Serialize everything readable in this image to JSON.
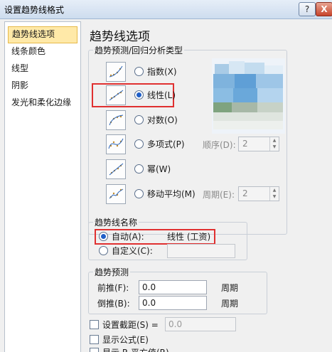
{
  "window": {
    "title": "设置趋势线格式",
    "help_label": "?",
    "close_label": "X"
  },
  "sidebar": {
    "items": [
      {
        "label": "趋势线选项"
      },
      {
        "label": "线条颜色"
      },
      {
        "label": "线型"
      },
      {
        "label": "阴影"
      },
      {
        "label": "发光和柔化边缘"
      }
    ]
  },
  "main": {
    "title": "趋势线选项",
    "type_group": {
      "label": "趋势预测/回归分析类型",
      "options": [
        {
          "label": "指数(X)"
        },
        {
          "label": "线性(L)"
        },
        {
          "label": "对数(O)"
        },
        {
          "label": "多项式(P)"
        },
        {
          "label": "幂(W)"
        },
        {
          "label": "移动平均(M)"
        }
      ],
      "selected": "线性(L)",
      "order_label": "顺序(D):",
      "order_value": "2",
      "period_label": "周期(E):",
      "period_value": "2"
    },
    "name_group": {
      "label": "趋势线名称",
      "auto_label": "自动(A):",
      "auto_value": "线性 (工资)",
      "custom_label": "自定义(C):",
      "custom_value": ""
    },
    "forecast_group": {
      "label": "趋势预测",
      "forward_label": "前推(F):",
      "forward_value": "0.0",
      "forward_unit": "周期",
      "backward_label": "倒推(B):",
      "backward_value": "0.0",
      "backward_unit": "周期"
    },
    "checks": {
      "intercept_label": "设置截距(S) =",
      "intercept_value": "0.0",
      "equation_label": "显示公式(E)",
      "rsquared_label": "显示 R 平方值(R)"
    }
  },
  "colors": {
    "selection_bg": "#ffe9a8",
    "highlight_red": "#e03030",
    "radio_accent": "#1f5fc8"
  },
  "icons": [
    "help-icon",
    "close-icon",
    "trendline-type-icon",
    "radio",
    "checkbox"
  ]
}
